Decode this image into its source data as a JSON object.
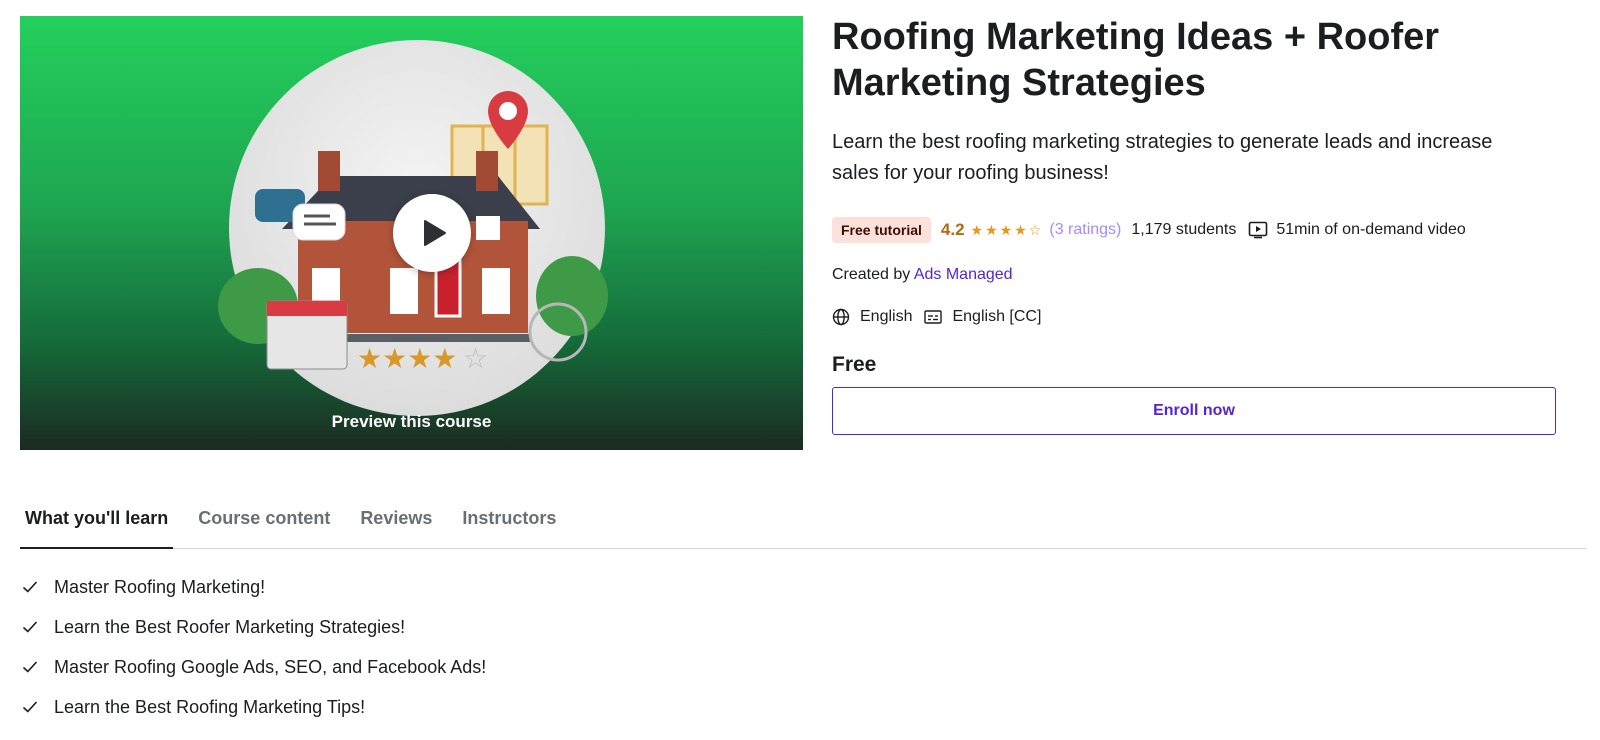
{
  "preview": {
    "label": "Preview this course",
    "play_icon": "play-icon",
    "illustration": "house-marketing-illustration"
  },
  "course": {
    "title": "Roofing Marketing Ideas + Roofer Marketing Strategies",
    "subtitle": "Learn the best roofing marketing strategies to generate leads and increase sales for your roofing business!",
    "badge": "Free tutorial",
    "rating": "4.2",
    "rating_value": 4.2,
    "rating_max": 5,
    "ratings_count": "(3 ratings)",
    "students": "1,179 students",
    "video": "51min of on-demand video",
    "created_label": "Created by",
    "instructor": "Ads Managed",
    "language": "English",
    "captions": "English [CC]",
    "price": "Free",
    "enroll_label": "Enroll now"
  },
  "tabs": [
    {
      "label": "What you'll learn",
      "active": true
    },
    {
      "label": "Course content",
      "active": false
    },
    {
      "label": "Reviews",
      "active": false
    },
    {
      "label": "Instructors",
      "active": false
    }
  ],
  "learn": [
    "Master Roofing Marketing!",
    "Learn the Best Roofer Marketing Strategies!",
    "Master Roofing Google Ads, SEO, and Facebook Ads!",
    "Learn the Best Roofing Marketing Tips!"
  ],
  "colors": {
    "accent": "#5624d0",
    "rating": "#b4690e",
    "star": "#e59819",
    "badge_bg": "#fbe0dc",
    "preview_green": "#23d05c"
  }
}
